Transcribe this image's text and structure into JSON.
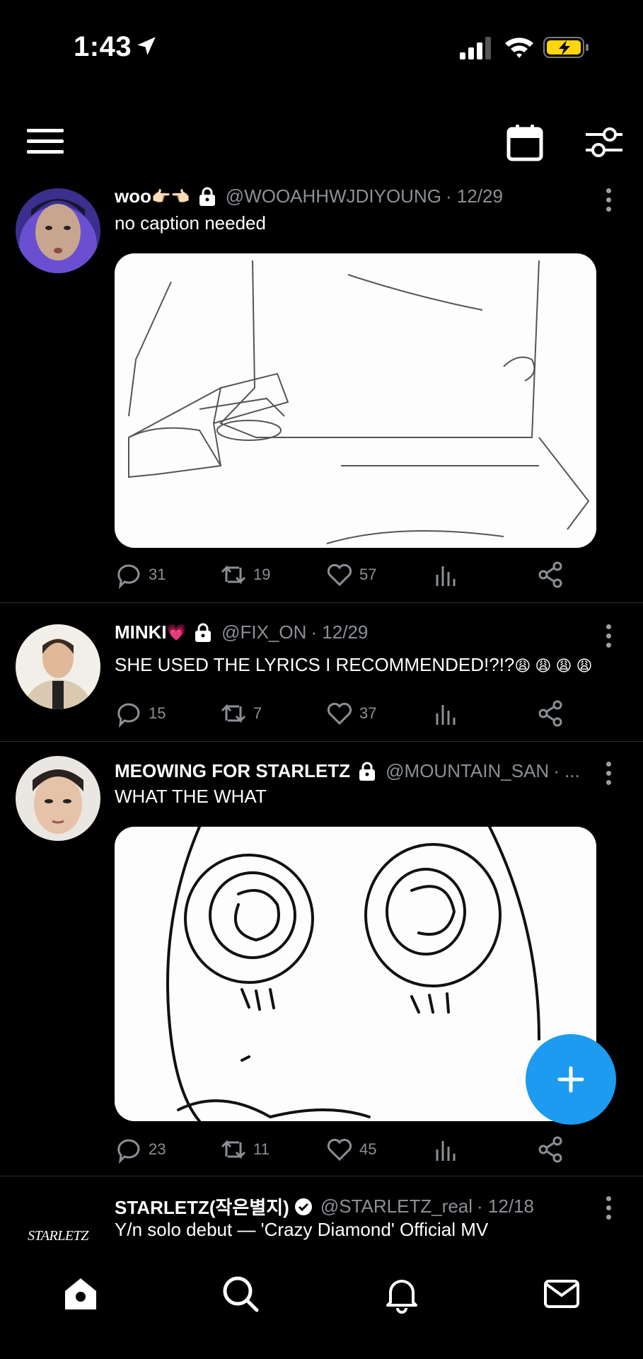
{
  "status_bar": {
    "time": "1:43"
  },
  "tweets": [
    {
      "name": "woo",
      "name_emoji": "👉🏻👈🏻",
      "handle": "@WOOAHHWJDIYOUNG",
      "date": "· 12/29",
      "text": "no caption needed",
      "has_lock": true,
      "stats": {
        "replies": "31",
        "retweets": "19",
        "likes": "57"
      }
    },
    {
      "name": "MINKI",
      "name_emoji": "💗",
      "handle": "@FIX_ON",
      "date": "· 12/29",
      "text": "SHE USED THE LYRICS I RECOMMENDED!?!?",
      "text_emoji": "😩 😩 😩 😩",
      "has_lock": true,
      "stats": {
        "replies": "15",
        "retweets": "7",
        "likes": "37"
      }
    },
    {
      "name": "MEOWING FOR STARLETZ",
      "handle": "@MOUNTAIN_SAN",
      "date": "· ...",
      "text": "WHAT THE WHAT",
      "has_lock": true,
      "stats": {
        "replies": "23",
        "retweets": "11",
        "likes": "45"
      }
    },
    {
      "name": "STARLETZ(작은별지)",
      "handle": "@STARLETZ_real",
      "date": "· 12/18",
      "text": "Y/n solo debut — 'Crazy Diamond' Official MV",
      "verified": true,
      "avatar_text": "STARLETZ"
    }
  ],
  "colors": {
    "accent": "#1d9bf0",
    "muted": "#8b8f96",
    "background": "#000000",
    "battery": "#ffd60a"
  }
}
